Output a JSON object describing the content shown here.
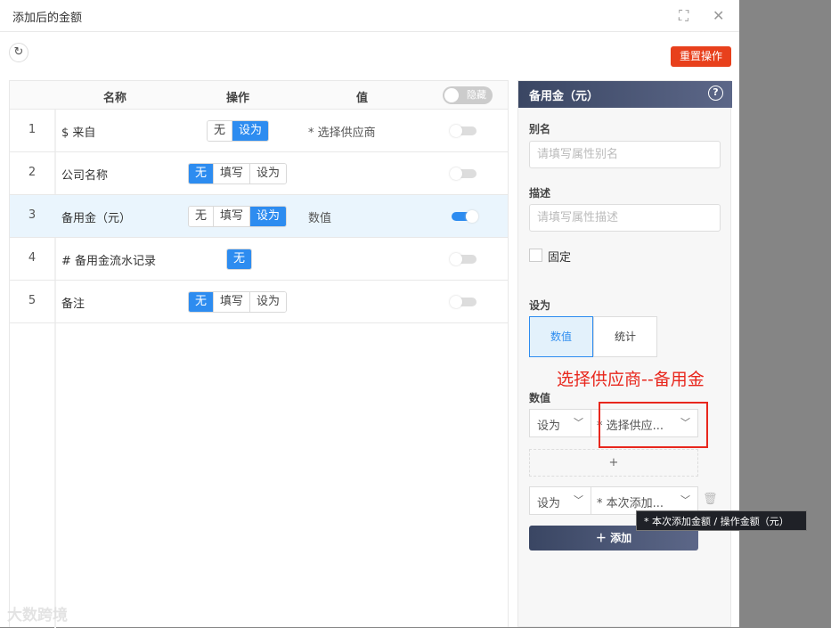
{
  "window": {
    "title": "添加后的金额",
    "expand_icon": "expand-icon",
    "close_icon": "close-icon"
  },
  "toolbar": {
    "refresh_icon": "refresh-icon",
    "reset_label": "重置操作"
  },
  "table": {
    "headers": {
      "name": "名称",
      "op": "操作",
      "value": "值",
      "hide_toggle": "隐藏"
    },
    "rows": [
      {
        "index": "1",
        "name": "$ 来自",
        "ops": [
          "无",
          "设为"
        ],
        "active": "设为",
        "value": "* 选择供应商",
        "enabled": false
      },
      {
        "index": "2",
        "name": "公司名称",
        "ops": [
          "无",
          "填写",
          "设为"
        ],
        "active": "无",
        "value": "",
        "enabled": false
      },
      {
        "index": "3",
        "name": "备用金（元）",
        "ops": [
          "无",
          "填写",
          "设为"
        ],
        "active": "设为",
        "value": "数值",
        "enabled": true,
        "selected": true
      },
      {
        "index": "4",
        "name": "# 备用金流水记录",
        "ops": [
          "无"
        ],
        "active": "无",
        "value": "",
        "enabled": false
      },
      {
        "index": "5",
        "name": "备注",
        "ops": [
          "无",
          "填写",
          "设为"
        ],
        "active": "无",
        "value": "",
        "enabled": false
      }
    ]
  },
  "panel": {
    "title": "备用金（元）",
    "alias_label": "别名",
    "alias_placeholder": "请填写属性别名",
    "desc_label": "描述",
    "desc_placeholder": "请填写属性描述",
    "fixed_label": "固定",
    "setas_label": "设为",
    "options": [
      "数值",
      "统计"
    ],
    "active_option": "数值",
    "annotation": "选择供应商--备用金",
    "value_label": "数值",
    "rule1": {
      "mode": "设为",
      "target": "* 选择供应..."
    },
    "add_row": "+",
    "rule2": {
      "mode": "设为",
      "target": "* 本次添加..."
    },
    "add_button": "添加",
    "tooltip": "* 本次添加金额 / 操作金额（元）"
  },
  "watermark": "大数跨境",
  "colors": {
    "primary": "#2d8cf0",
    "reset": "#e8401c",
    "annotation": "#e8271d",
    "panel_header": "#3a4663"
  }
}
